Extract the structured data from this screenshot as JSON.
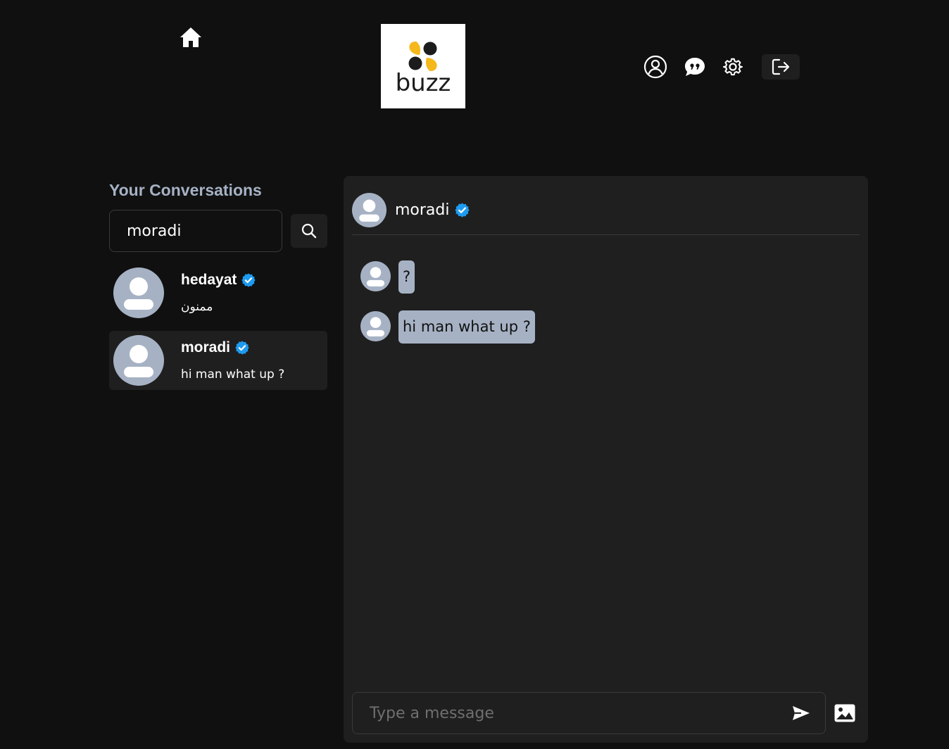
{
  "header": {
    "logo_text": "buzz",
    "logo_colors": {
      "yellow": "#f5b81b",
      "dark": "#1c1c1c"
    },
    "nav": [
      {
        "id": "profile",
        "icon": "user-circle-icon"
      },
      {
        "id": "messages",
        "icon": "chat-quote-icon"
      },
      {
        "id": "settings",
        "icon": "gear-icon"
      },
      {
        "id": "logout",
        "icon": "logout-icon"
      }
    ],
    "home_icon": "home-icon"
  },
  "sidebar": {
    "title": "Your Conversations",
    "search": {
      "value": "moradi",
      "placeholder": ""
    },
    "conversations": [
      {
        "name": "hedayat",
        "verified": true,
        "last_message": "ممنون",
        "active": false
      },
      {
        "name": "moradi",
        "verified": true,
        "last_message": "hi man what up ?",
        "active": true
      }
    ]
  },
  "chat": {
    "recipient": {
      "name": "moradi",
      "verified": true
    },
    "messages": [
      {
        "text": "?"
      },
      {
        "text": "hi man what up ?"
      }
    ],
    "composer": {
      "placeholder": "Type a message"
    }
  },
  "colors": {
    "background": "#101010",
    "panel": "#1f1f1f",
    "accent_text": "#a6b2c4",
    "bubble": "#a6b2c4",
    "verified_badge": "#1d9bf0",
    "avatar_bg": "#a6b2c4"
  }
}
